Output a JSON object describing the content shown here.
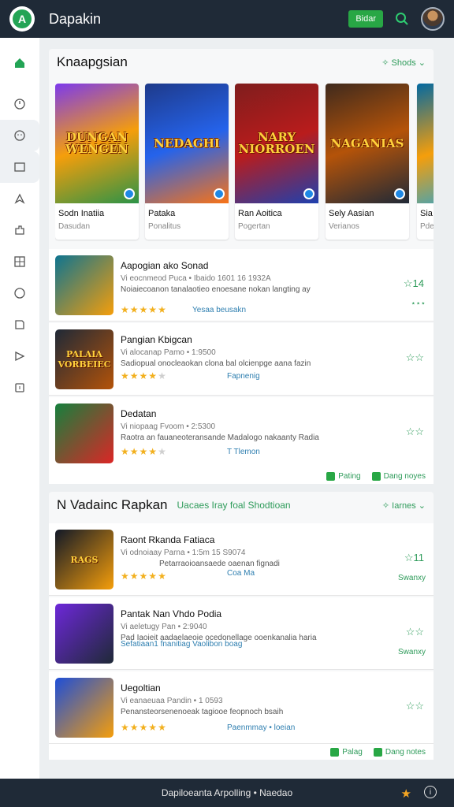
{
  "app": {
    "title": "Dapakin",
    "top_button": "Bidar",
    "logo_glyph": "A"
  },
  "nav": [
    "home-icon",
    "clock-icon",
    "face-icon",
    "square-icon",
    "compass-icon",
    "puzzle-icon",
    "grid-icon",
    "circle-icon",
    "book-icon",
    "flag-icon",
    "box-icon"
  ],
  "section1": {
    "title": "Knaapgsian",
    "link": "Shods",
    "cards": [
      {
        "art": "DUNGAN WENGEN",
        "name": "Sodn Inatiia",
        "sub": "Dasudan",
        "colors": [
          "#7c3aed",
          "#f59e0b",
          "#2b9348"
        ]
      },
      {
        "art": "NEDAGHI",
        "name": "Pataka",
        "sub": "Ponalitus",
        "colors": [
          "#1e3a8a",
          "#2563eb",
          "#f97316"
        ]
      },
      {
        "art": "NARY NIORROEN",
        "name": "Ran Aoitica",
        "sub": "Pogertan",
        "colors": [
          "#7f1d1d",
          "#b91c1c",
          "#1e40af"
        ]
      },
      {
        "art": "NAGANIAS",
        "name": "Sely Aasian",
        "sub": "Verianos",
        "colors": [
          "#3f2a1d",
          "#b45309",
          "#1f2937"
        ]
      },
      {
        "art": "",
        "name": "Sia",
        "sub": "Pde",
        "colors": [
          "#0369a1",
          "#f59e0b",
          "#0ea5e9"
        ]
      }
    ],
    "rows": [
      {
        "thumb": "",
        "title": "Aapogian ako Sonad",
        "meta": "Vi eocnmeod Puca • Ibaido 1601 16 1932A",
        "desc": "Noiaiecoanon tanalaotieo enoesane nokan langting ay",
        "link": "Yesaa beusakn",
        "rating": 5,
        "fav": "☆14",
        "tag": "⋆⋆⋆",
        "colors": [
          "#0e7490",
          "#f59e0b"
        ]
      },
      {
        "thumb": "PALAIA VORBEIEC",
        "title": "Pangian Kbigcan",
        "meta": "Vi alocanap Pamo • 1:9500",
        "desc": "Sadiopual onocleaokan clona bal olcienpge aana fazin",
        "link": "Fapnenig",
        "rating": 4,
        "fav": "☆☆",
        "tag": "",
        "colors": [
          "#1f2937",
          "#b45309"
        ]
      },
      {
        "thumb": "",
        "title": "Dedatan",
        "meta": "Vi niopaag Fvoom • 2:5300",
        "desc": "Raotra an fauaneoteransande Madalogo nakaanty Radia",
        "link": "T Tlemon",
        "rating": 4,
        "fav": "☆☆",
        "tag": "",
        "colors": [
          "#15803d",
          "#dc2626"
        ]
      }
    ],
    "footer": [
      "Pating",
      "Dang noyes"
    ]
  },
  "section2": {
    "title": "N Vadainc Rapkan",
    "subtitle": "Uacaes Iray foal Shodtioan",
    "link": "Iarnes",
    "rows": [
      {
        "thumb": "RAGS",
        "title": "Raont Rkanda Fatiaca",
        "meta": "Vi odnoiaay Parna • 1:5m 15 S9074",
        "desc": "Petarraoioansaede oaenan fignadi",
        "link": "Coa Ma",
        "rating": 5,
        "fav": "☆11",
        "tag": "Swanxy",
        "colors": [
          "#111827",
          "#f59e0b"
        ]
      },
      {
        "thumb": "",
        "title": "Pantak Nan Vhdo Podia",
        "meta": "Vi aeletugy Pan • 2:9040",
        "desc": "Pad Iaoieit aadaelaeoie ocedonellage ooenkanalia haria",
        "link": "Sefatiaan1 fnanitiag Vaolibon boag",
        "rating": 0,
        "fav": "☆☆",
        "tag": "Swanxy",
        "colors": [
          "#6d28d9",
          "#1f2937"
        ]
      },
      {
        "thumb": "",
        "title": "Uegoltian",
        "meta": "Vi eanaeuaa Pandin • 1 0593",
        "desc": "Penansteorsenenoeak tagiooe feopnoch bsaih",
        "link": "Paenmmay • loeian",
        "rating": 5,
        "fav": "☆☆",
        "tag": "",
        "colors": [
          "#1d4ed8",
          "#f59e0b"
        ]
      }
    ],
    "footer": [
      "Palag",
      "Dang notes"
    ]
  },
  "bottom": {
    "text": "Dapiloeanta Arpolling • Naedao"
  }
}
